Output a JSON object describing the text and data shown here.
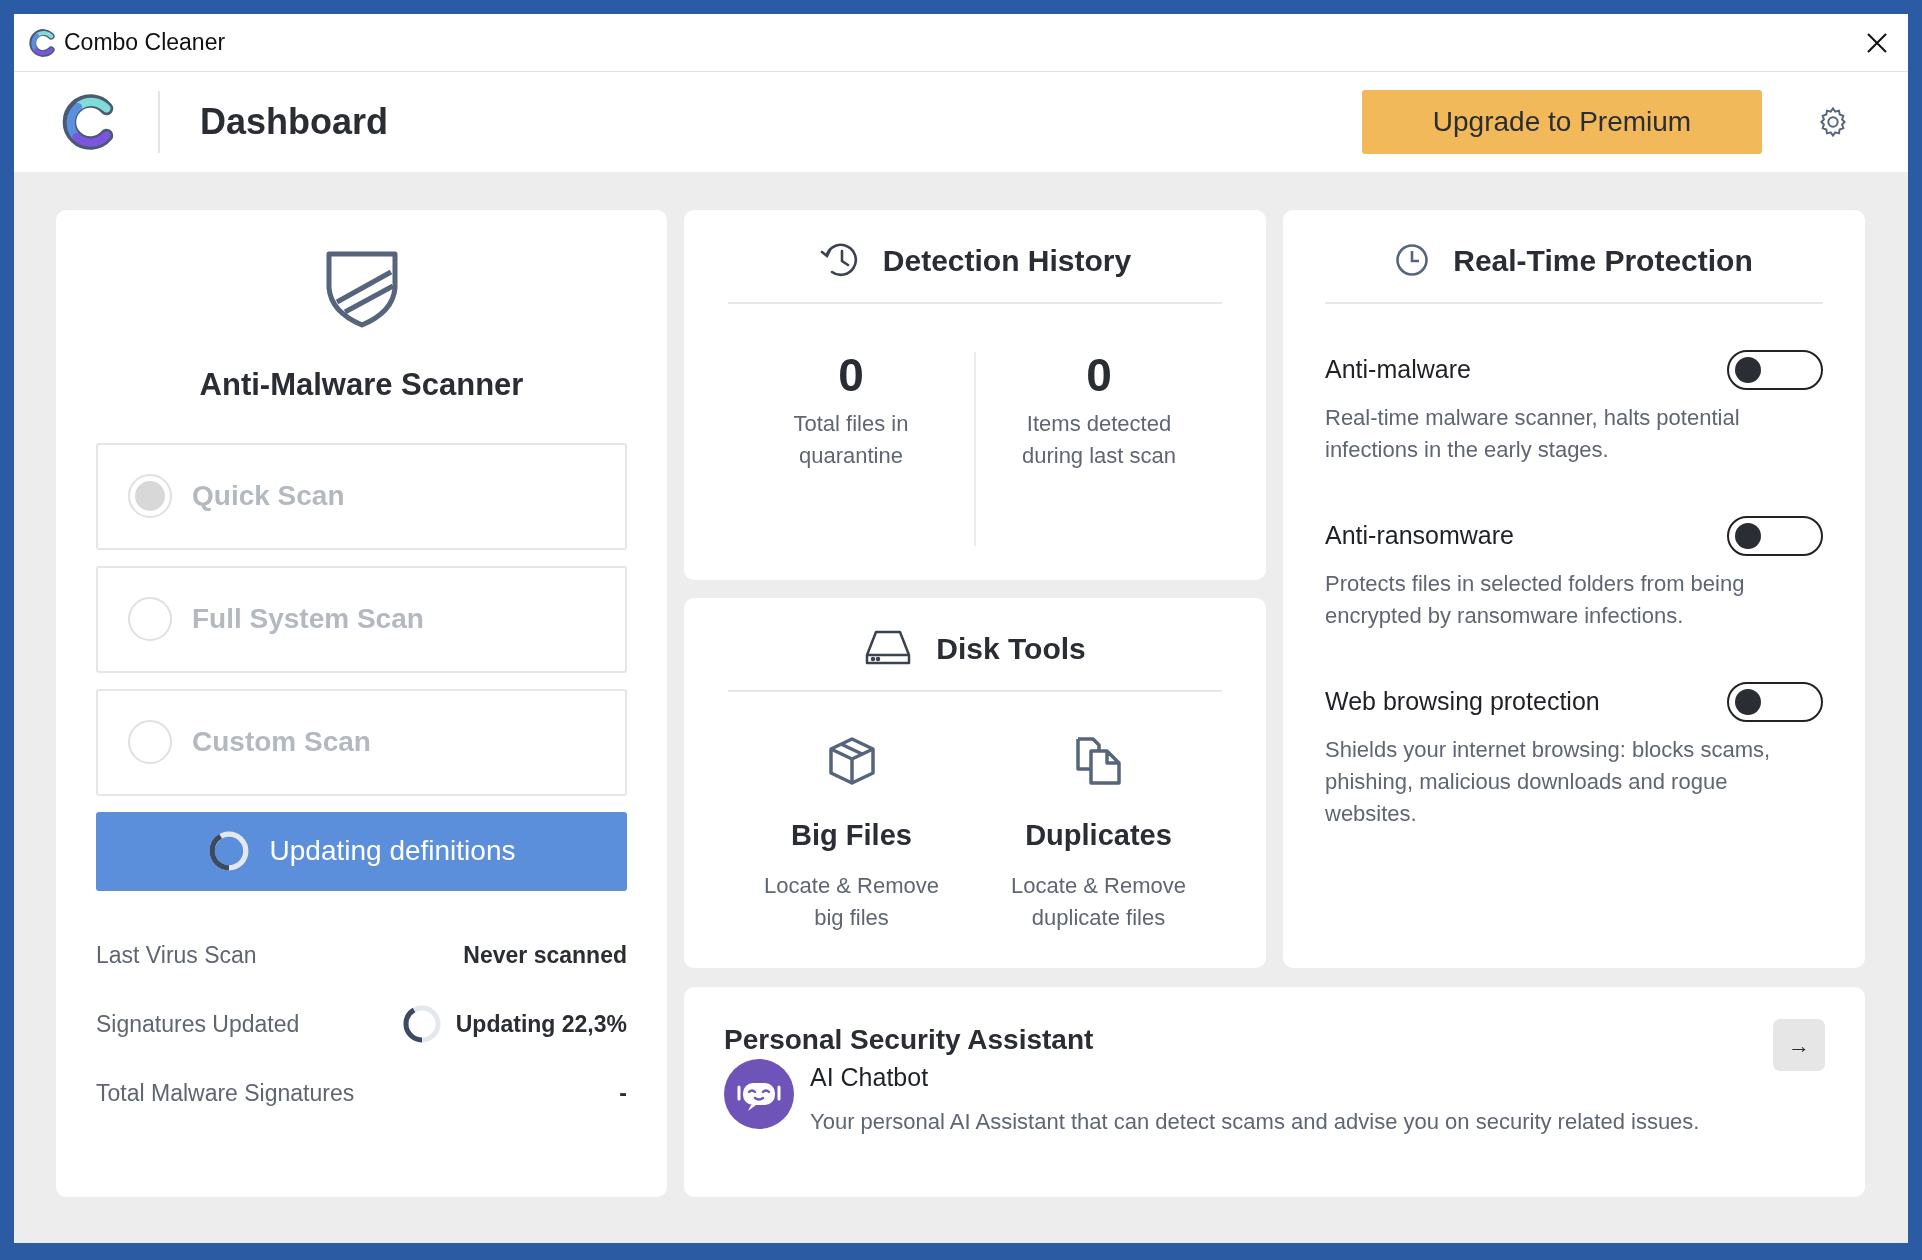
{
  "window": {
    "title": "Combo Cleaner"
  },
  "header": {
    "title": "Dashboard",
    "upgrade_button": "Upgrade to Premium"
  },
  "scanner": {
    "title": "Anti-Malware Scanner",
    "scan_options": [
      {
        "label": "Quick Scan",
        "selected": true,
        "disabled": true
      },
      {
        "label": "Full System Scan",
        "selected": false,
        "disabled": true
      },
      {
        "label": "Custom Scan",
        "selected": false,
        "disabled": true
      }
    ],
    "action_button": {
      "label": "Updating definitions",
      "busy": true
    },
    "info": [
      {
        "label": "Last Virus Scan",
        "value": "Never scanned",
        "busy": false
      },
      {
        "label": "Signatures Updated",
        "value": "Updating 22,3%",
        "busy": true
      },
      {
        "label": "Total Malware Signatures",
        "value": "-",
        "busy": false
      }
    ]
  },
  "detection_history": {
    "title": "Detection History",
    "stats": [
      {
        "value": "0",
        "label": "Total files in quarantine"
      },
      {
        "value": "0",
        "label": "Items detected during last scan"
      }
    ]
  },
  "disk_tools": {
    "title": "Disk Tools",
    "tools": [
      {
        "kind": "box",
        "title": "Big Files",
        "description": "Locate & Remove big files"
      },
      {
        "kind": "copies",
        "title": "Duplicates",
        "description": "Locate & Remove duplicate files"
      }
    ]
  },
  "real_time_protection": {
    "title": "Real-Time Protection",
    "items": [
      {
        "name": "Anti-malware",
        "on": false,
        "description": "Real-time malware scanner, halts potential infections in the early stages."
      },
      {
        "name": "Anti-ransomware",
        "on": false,
        "description": "Protects files in selected folders from being encrypted by ransomware infections."
      },
      {
        "name": "Web browsing protection",
        "on": false,
        "description": "Shields your internet browsing: blocks scams, phishing, malicious downloads and rogue websites."
      }
    ]
  },
  "assistant": {
    "title": "Personal Security Assistant",
    "open_button": "→",
    "item": {
      "name": "AI Chatbot",
      "description": "Your personal AI Assistant that can detect scams and advise you on security related issues."
    }
  }
}
